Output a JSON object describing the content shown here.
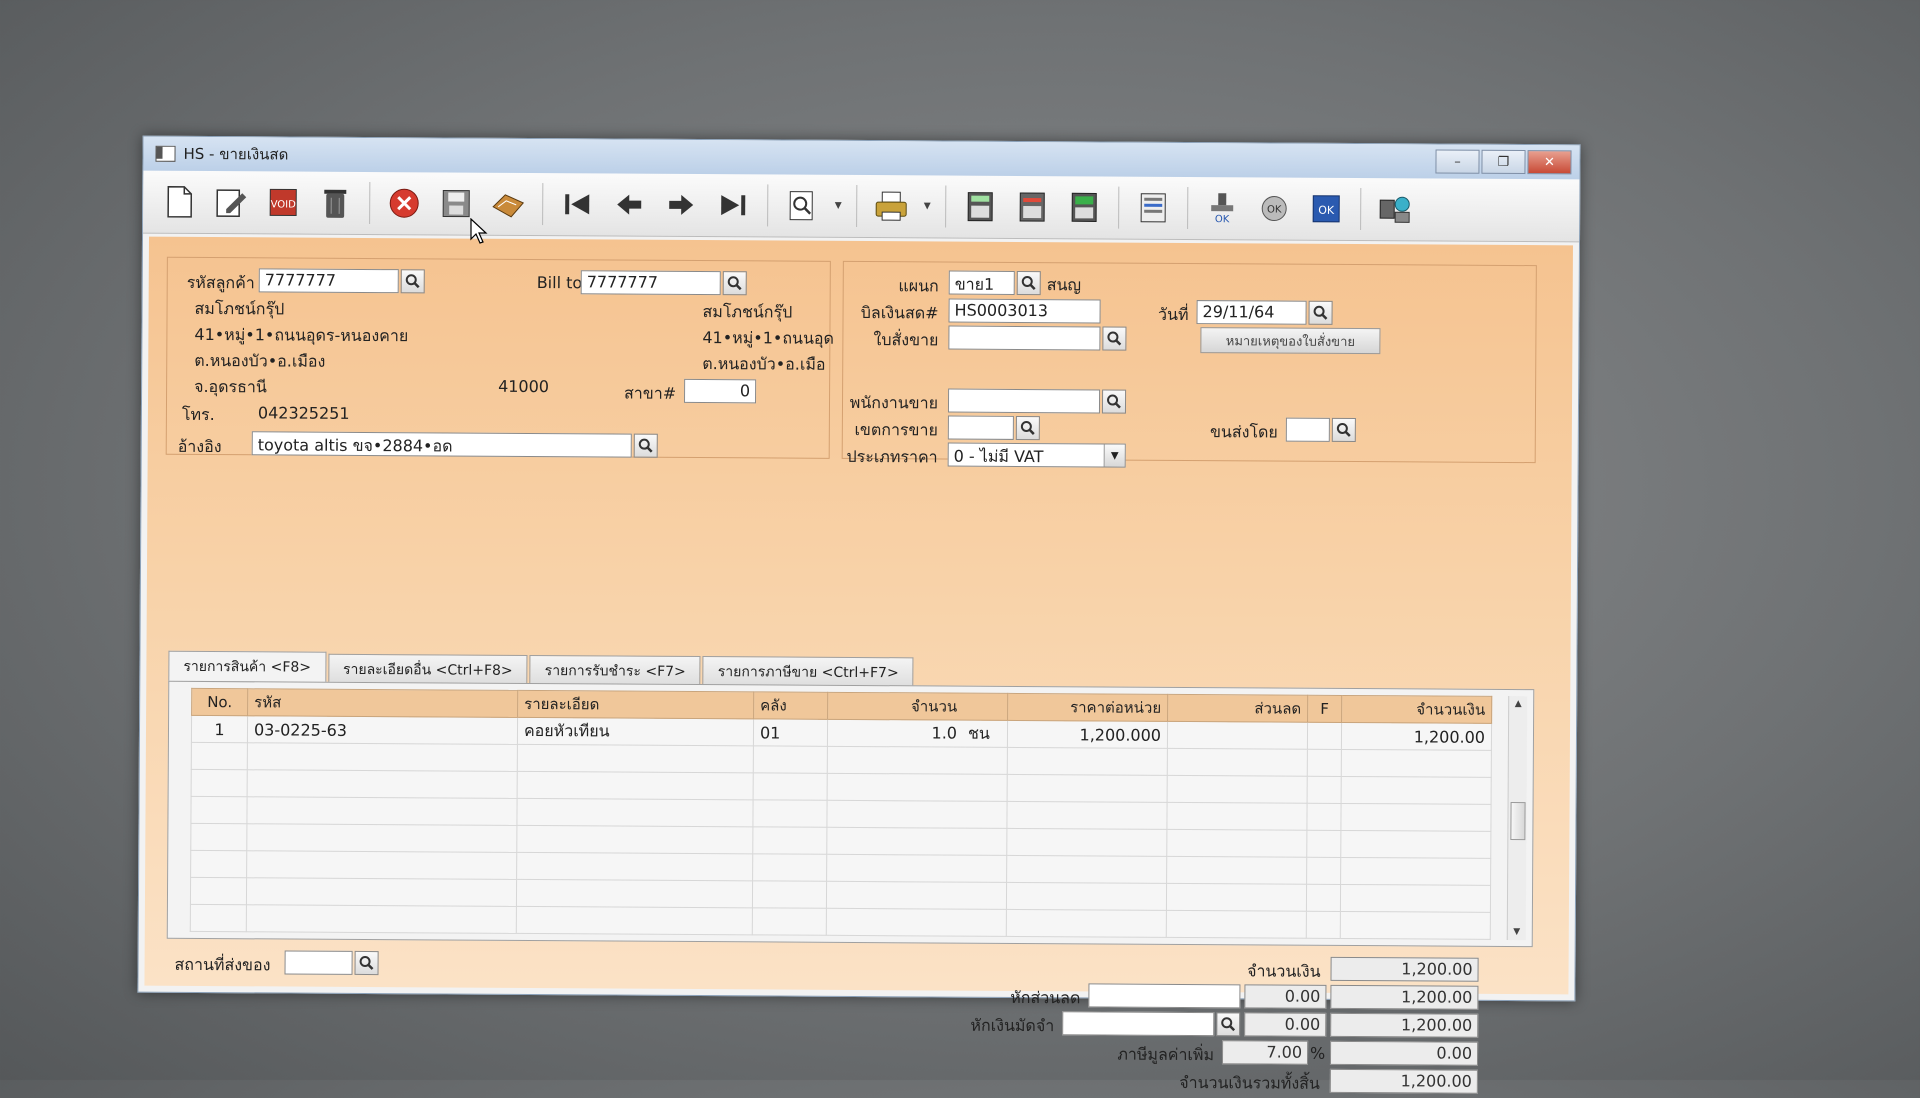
{
  "window": {
    "title": "HS - ขายเงินสด"
  },
  "toolbar": {
    "icons": [
      "new-doc-icon",
      "edit-icon",
      "void-icon",
      "delete-bin-icon",
      "cancel-icon",
      "save-icon",
      "approve-icon",
      "first-record-icon",
      "prev-record-icon",
      "next-record-icon",
      "last-record-icon",
      "search-doc-icon",
      "print-icon",
      "calc-icon",
      "report-icon",
      "sub-report-icon",
      "receipt-icon",
      "ok-stamp-icon",
      "approve-cancel-icon",
      "ok-doc-icon",
      "network-icon"
    ]
  },
  "customer": {
    "code_label": "รหัสลูกค้า",
    "code_value": "7777777",
    "bill_to_label": "Bill to",
    "bill_to_value": "7777777",
    "name": "สมโภชน์กรุ๊ป",
    "address1": "41•หมู่•1•ถนนอุดร-หนองคาย",
    "address2": "ต.หนองบัว•อ.เมือง",
    "province": "จ.อุดรธานี",
    "postcode": "41000",
    "branch_label": "สาขา#",
    "branch_value": "0",
    "phone_label": "โทร.",
    "phone_value": "042325251",
    "billto_name": "สมโภชน์กรุ๊ป",
    "billto_address1": "41•หมู่•1•ถนนอุด",
    "billto_address2": "ต.หนองบัว•อ.เมือ",
    "ref_label": "อ้างอิง",
    "ref_value": "toyota altis ขจ•2884•อด"
  },
  "doc": {
    "dept_label": "แผนก",
    "dept_value": "ขาย1",
    "dept_name": "สนญ",
    "bill_label": "บิลเงินสด#",
    "bill_value": "HS0003013",
    "date_label": "วันที่",
    "date_value": "29/11/64",
    "order_label": "ใบสั่งขาย",
    "order_value": "",
    "order_note_button": "หมายเหตุของใบสั่งขาย",
    "salesman_label": "พนักงานขาย",
    "salesman_value": "",
    "area_label": "เขตการขาย",
    "area_value": "",
    "ship_by_label": "ขนส่งโดย",
    "ship_by_value": "",
    "price_type_label": "ประเภทราคา",
    "price_type_value": "0 - ไม่มี VAT"
  },
  "tabs": [
    {
      "label": "รายการสินค้า <F8>"
    },
    {
      "label": "รายละเอียดอื่น <Ctrl+F8>"
    },
    {
      "label": "รายการรับชำระ <F7>"
    },
    {
      "label": "รายการภาษีขาย <Ctrl+F7>"
    }
  ],
  "grid": {
    "headers": [
      "No.",
      "รหัส",
      "รายละเอียด",
      "คลัง",
      "จำนวน",
      "ราคาต่อหน่วย",
      "ส่วนลด",
      "F",
      "จำนวนเงิน"
    ],
    "rows": [
      {
        "no": "1",
        "code": "03-0225-63",
        "desc": "คอยหัวเทียน",
        "wh": "01",
        "qty": "1.0",
        "unit": "ชน",
        "price": "1,200.000",
        "disc": "",
        "f": "",
        "amount": "1,200.00"
      }
    ]
  },
  "footer": {
    "ship_place_label": "สถานที่ส่งของ",
    "ship_place_value": "",
    "amount_label": "จำนวนเงิน",
    "amount_value": "1,200.00",
    "discount_label": "หักส่วนลด",
    "discount_text": "",
    "discount_value": "0.00",
    "discount_total": "1,200.00",
    "deposit_label": "หักเงินมัดจำ",
    "deposit_text": "",
    "deposit_value": "0.00",
    "deposit_total": "1,200.00",
    "vat_label": "ภาษีมูลค่าเพิ่ม",
    "vat_rate": "7.00",
    "vat_pct": "%",
    "vat_value": "0.00",
    "grand_total_label": "จำนวนเงินรวมทั้งสิ้น",
    "grand_total_value": "1,200.00"
  },
  "colors": {
    "form_bg": "#f8d2a8",
    "grid_header": "#f0c79a",
    "titlebar": "#c9d9ec"
  }
}
